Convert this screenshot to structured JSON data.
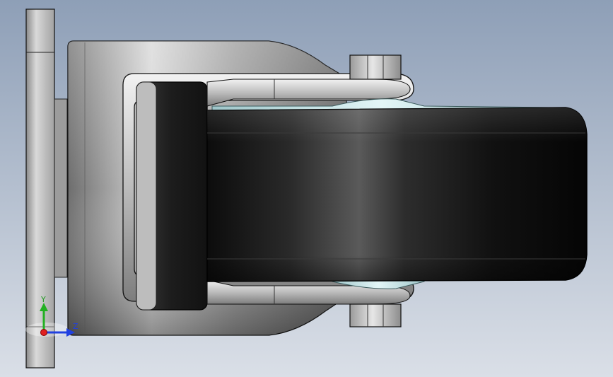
{
  "viewport": {
    "background_top": "#8fa0b8",
    "background_bottom": "#d8dde6"
  },
  "model": {
    "parts": [
      {
        "name": "mounting-plate",
        "color": "#b9b9b9"
      },
      {
        "name": "swivel-housing",
        "color": "#a9a9a9"
      },
      {
        "name": "fork-upper-arm",
        "color": "#bdbdbd"
      },
      {
        "name": "fork-lower-arm",
        "color": "#bdbdbd"
      },
      {
        "name": "axle-nut-top",
        "color": "#c8c8c8"
      },
      {
        "name": "axle-nut-bottom",
        "color": "#c8c8c8"
      },
      {
        "name": "wheel-tire",
        "color": "#1b1b1b"
      },
      {
        "name": "wheel-hub",
        "color": "#cfe8ea"
      },
      {
        "name": "bumper-pad",
        "color": "#222222"
      }
    ]
  },
  "triad": {
    "y_label": "Y",
    "z_label": "Z",
    "x_color": "#e02020",
    "y_color": "#22b022",
    "z_color": "#2040e0"
  }
}
